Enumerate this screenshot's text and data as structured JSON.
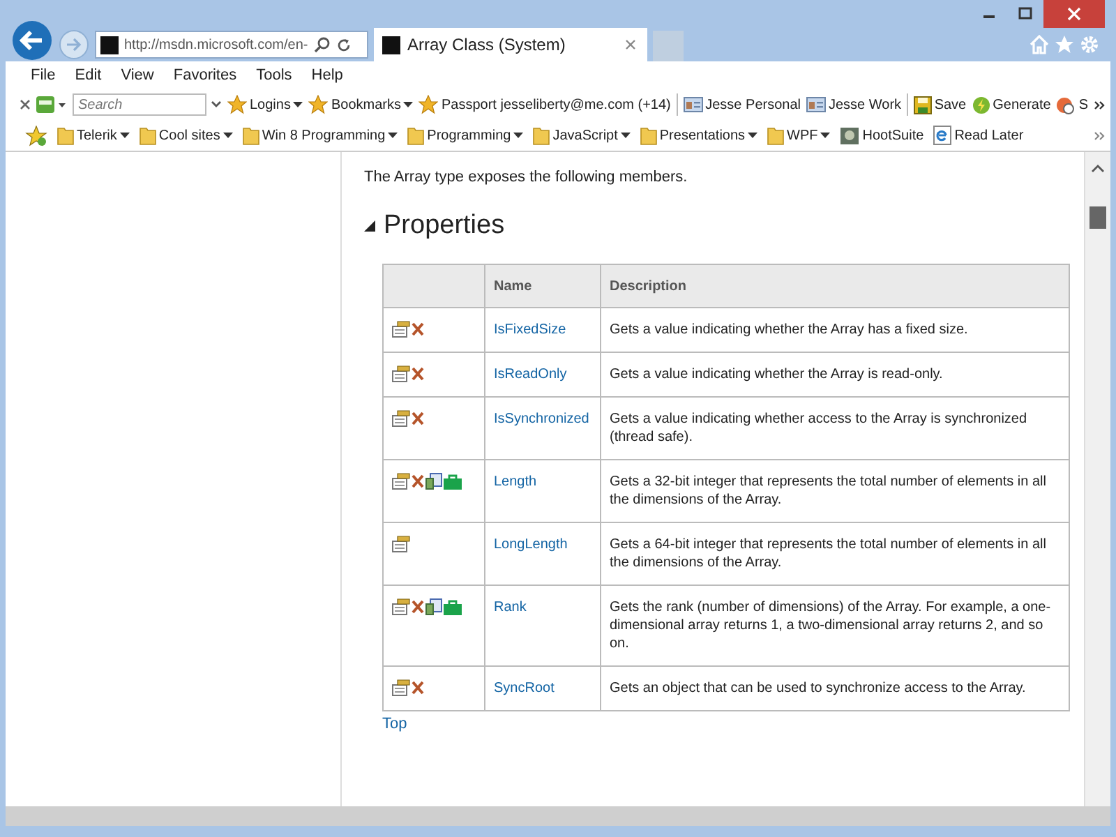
{
  "address_bar": {
    "url": "http://msdn.microsoft.com/en-"
  },
  "tabs": [
    {
      "title": "Array Class (System)",
      "selected": true
    }
  ],
  "menu": [
    "File",
    "Edit",
    "View",
    "Favorites",
    "Tools",
    "Help"
  ],
  "command_bar": {
    "search": {
      "placeholder": "Search"
    },
    "items": [
      {
        "label": "Logins",
        "kind": "star",
        "dropdown": true
      },
      {
        "label": "Bookmarks",
        "kind": "star",
        "dropdown": true
      },
      {
        "label": "Passport jesseliberty@me.com (+14)",
        "kind": "star",
        "dropdown": false
      },
      {
        "label": "Jesse Personal",
        "kind": "card",
        "dropdown": false
      },
      {
        "label": "Jesse Work",
        "kind": "card",
        "dropdown": false
      },
      {
        "label": "Save",
        "kind": "disk",
        "dropdown": false
      },
      {
        "label": "Generate",
        "kind": "bolt",
        "dropdown": false
      },
      {
        "label": "S",
        "kind": "gear",
        "dropdown": false
      }
    ]
  },
  "favorites_bar": [
    {
      "label": "Telerik",
      "kind": "folder",
      "dropdown": true
    },
    {
      "label": "Cool sites",
      "kind": "folder",
      "dropdown": true
    },
    {
      "label": "Win 8 Programming",
      "kind": "folder",
      "dropdown": true
    },
    {
      "label": "Programming",
      "kind": "folder",
      "dropdown": true
    },
    {
      "label": "JavaScript",
      "kind": "folder",
      "dropdown": true
    },
    {
      "label": "Presentations",
      "kind": "folder",
      "dropdown": true
    },
    {
      "label": "WPF",
      "kind": "folder",
      "dropdown": true
    },
    {
      "label": "HootSuite",
      "kind": "app",
      "dropdown": false
    },
    {
      "label": "Read Later",
      "kind": "page",
      "dropdown": false
    }
  ],
  "content": {
    "intro": "The Array type exposes the following members.",
    "heading": "Properties",
    "table": {
      "columns": [
        "Name",
        "Description"
      ],
      "rows": [
        {
          "icons": [
            {
              "kind": "property"
            },
            {
              "kind": "xna"
            }
          ],
          "name": "IsFixedSize",
          "description": "Gets a value indicating whether the Array has a fixed size."
        },
        {
          "icons": [
            {
              "kind": "property"
            },
            {
              "kind": "xna"
            }
          ],
          "name": "IsReadOnly",
          "description": "Gets a value indicating whether the Array is read-only."
        },
        {
          "icons": [
            {
              "kind": "property"
            },
            {
              "kind": "xna"
            }
          ],
          "name": "IsSynchronized",
          "description": "Gets a value indicating whether access to the Array is synchronized (thread safe)."
        },
        {
          "icons": [
            {
              "kind": "property"
            },
            {
              "kind": "xna"
            },
            {
              "kind": "store"
            },
            {
              "kind": "portable"
            }
          ],
          "name": "Length",
          "description": "Gets a 32-bit integer that represents the total number of elements in all the dimensions of the Array."
        },
        {
          "icons": [
            {
              "kind": "property"
            }
          ],
          "name": "LongLength",
          "description": "Gets a 64-bit integer that represents the total number of elements in all the dimensions of the Array."
        },
        {
          "icons": [
            {
              "kind": "property"
            },
            {
              "kind": "xna"
            },
            {
              "kind": "store"
            },
            {
              "kind": "portable"
            }
          ],
          "name": "Rank",
          "description": "Gets the rank (number of dimensions) of the Array. For example, a one-dimensional array returns 1, a two-dimensional array returns 2, and so on."
        },
        {
          "icons": [
            {
              "kind": "property"
            },
            {
              "kind": "xna"
            }
          ],
          "name": "SyncRoot",
          "description": "Gets an object that can be used to synchronize access to the Array."
        }
      ]
    },
    "top_link": "Top"
  }
}
